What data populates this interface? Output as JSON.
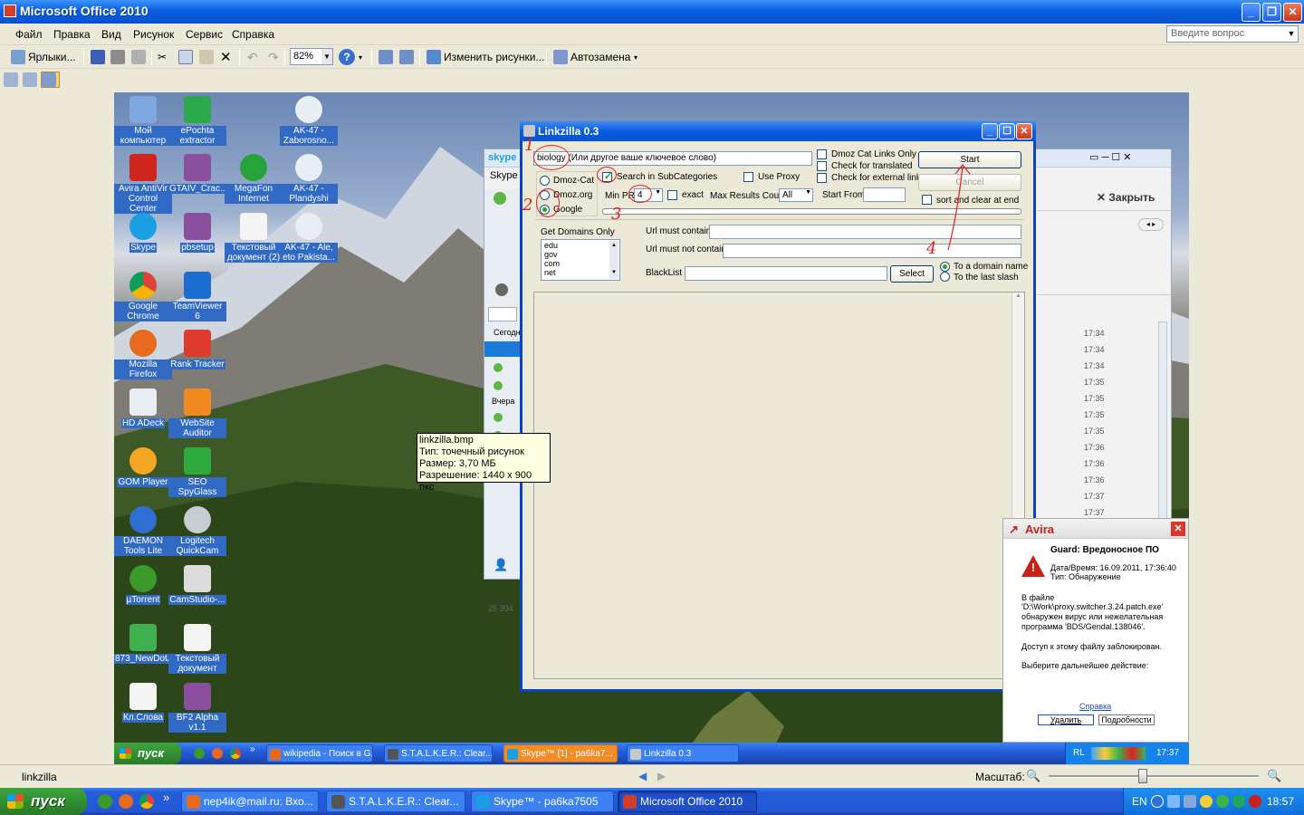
{
  "window": {
    "title": "Microsoft Office 2010"
  },
  "menu": [
    "Файл",
    "Правка",
    "Вид",
    "Рисунок",
    "Сервис",
    "Справка"
  ],
  "help_placeholder": "Введите вопрос",
  "toolbar": {
    "shortcuts": "Ярлыки...",
    "zoom": "82%",
    "edit_pictures": "Изменить рисунки...",
    "autocorrect": "Автозамена"
  },
  "desktop_icons": [
    {
      "label": "Мой компьютер"
    },
    {
      "label": "ePochta extractor"
    },
    {
      "label": "AK-47 - Zaborosno..."
    },
    {
      "label": "Avira AntiVir Control Center"
    },
    {
      "label": "GTAIV_Crac..."
    },
    {
      "label": "MegaFon Internet"
    },
    {
      "label": "AK-47 - Plandyshi"
    },
    {
      "label": "Skype"
    },
    {
      "label": "pbsetup"
    },
    {
      "label": "Текстовый документ (2)"
    },
    {
      "label": "AK-47 - Ale, eto Pakista..."
    },
    {
      "label": "Google Chrome"
    },
    {
      "label": "TeamViewer 6"
    },
    {
      "label": "Mozilla Firefox"
    },
    {
      "label": "Rank Tracker"
    },
    {
      "label": "HD ADeck"
    },
    {
      "label": "WebSite Auditor"
    },
    {
      "label": "GOM Player"
    },
    {
      "label": "SEO SpyGlass"
    },
    {
      "label": "DAEMON Tools Lite"
    },
    {
      "label": "Logitech QuickCam"
    },
    {
      "label": "µTorrent"
    },
    {
      "label": "CamStudio-..."
    },
    {
      "label": "873_NewDotA"
    },
    {
      "label": "Текстовый документ"
    },
    {
      "label": "Кл.Слова"
    },
    {
      "label": "BF2 Alpha v1.1"
    }
  ],
  "tooltip": {
    "line1": "linkzilla.bmp",
    "line2": "Тип: точечный рисунок",
    "line3": "Размер: 3,70 МБ",
    "line4": "Разрешение: 1440 x 900 пкс"
  },
  "skype": {
    "title": "Skype",
    "close_label": "Закрыть",
    "today": "Сегодн",
    "yesterday": "Вчера",
    "status": "25 394",
    "times": [
      "17:34",
      "17:34",
      "17:34",
      "17:35",
      "17:35",
      "17:35",
      "17:35",
      "17:36",
      "17:36",
      "17:36",
      "17:37",
      "17:37"
    ]
  },
  "linkzilla": {
    "title": "Linkzilla 0.3",
    "keyword_value": "biology (Или другое ваше ключевое слово)",
    "options": {
      "dmoz_cat": "Dmoz-Cat",
      "dmoz_org": "Dmoz.org",
      "google": "Google",
      "search_subcats": "Search in SubCategories",
      "use_proxy": "Use Proxy",
      "min_pr_label": "Min PR",
      "min_pr_value": "4",
      "exact": "exact",
      "max_results_label": "Max Results Count",
      "max_results_value": "All",
      "start_from": "Start From",
      "dmoz_cat_links_only": "Dmoz Cat Links Only",
      "check_translated": "Check for translated",
      "check_external": "Check for external links",
      "sort_clear": "sort and clear at end"
    },
    "start_button": "Start",
    "cancel_button": "Cancel",
    "get_domains_label": "Get Domains Only",
    "domains": [
      "edu",
      "gov",
      "com",
      "net"
    ],
    "url_must_contain": "Url must contain",
    "url_must_not_contain": "Url must not contain",
    "blacklist": "BlackList",
    "select_button": "Select",
    "to_domain": "To a domain name",
    "to_last_slash": "To the last slash",
    "annotations": [
      "1",
      "2",
      "3",
      "4"
    ]
  },
  "avira": {
    "title": "Avira",
    "heading": "Guard: Вредоносное ПО",
    "datetime": "Дата/Время: 16.09.2011, 17:36:40",
    "type": "Тип: Обнаружение",
    "file_intro": "В файле",
    "file_path": "'D:\\Work\\proxy.switcher.3.24.patch.exe'",
    "virus_found": "обнаружен вирус или нежелательная",
    "program": "программа 'BDS/Gendal.138046'.",
    "blocked": "Доступ к этому файлу заблокирован.",
    "choose": "Выберите дальнейшее действие:",
    "help": "Справка",
    "delete_btn": "Удалить",
    "details_btn": "Подробности"
  },
  "inner_taskbar": {
    "start": "пуск",
    "tasks": [
      "wikipedia - Поиск в G...",
      "S.T.A.L.K.E.R.: Clear...",
      "Skype™ [1] - pa6ka7...",
      "Linkzilla 0.3"
    ],
    "lang": "RL",
    "time": "17:37"
  },
  "statusbar": {
    "filename": "linkzilla",
    "scale_label": "Масштаб:",
    "zoom_fraction": 0.45
  },
  "taskbar": {
    "start": "пуск",
    "tasks": [
      "nep4ik@mail.ru: Вхо...",
      "S.T.A.L.K.E.R.: Clear...",
      "Skype™ - pa6ka7505",
      "Microsoft Office 2010"
    ],
    "lang": "EN",
    "time": "18:57"
  }
}
